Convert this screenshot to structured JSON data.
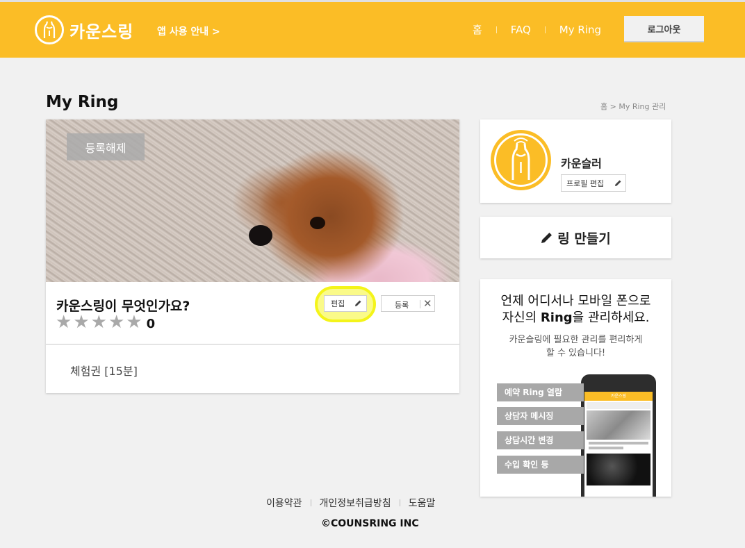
{
  "header": {
    "brand": "카운스링",
    "guide_link": "앱 사용 안내 >",
    "nav": [
      "홈",
      "FAQ",
      "My Ring"
    ],
    "logout": "로그아웃",
    "brand_color": "#fbbd26"
  },
  "page": {
    "title": "My Ring",
    "breadcrumb": "홈 > My Ring 관리"
  },
  "ring_card": {
    "unregister": "등록해제",
    "title": "카운스링이 무엇인가요?",
    "stars_filled": 0,
    "stars_total": 5,
    "rating_count": "0",
    "edit": "편집",
    "register": "등록",
    "voucher": "체험권 [15분]"
  },
  "profile": {
    "name": "카운슬러",
    "edit": "프로필 편집"
  },
  "make_ring": {
    "label": "링 만들기"
  },
  "promo": {
    "headline_line1": "언제 어디서나 모바일 폰으로",
    "headline_line2_pre": "자신의 ",
    "headline_line2_bold": "Ring",
    "headline_line2_post": "을 관리하세요.",
    "sub_line1": "카운슬링에 필요한 관리를 편리하게",
    "sub_line2": "할 수 있습니다!",
    "features": [
      "예약 Ring 열람",
      "상담자 메시징",
      "상담시간 변경",
      "수입 확인 등"
    ],
    "phone_bar": "카운스링"
  },
  "footer": {
    "links": [
      "이용약관",
      "개인정보취급방침",
      "도움말"
    ],
    "copyright": "©COUNSRING INC"
  }
}
